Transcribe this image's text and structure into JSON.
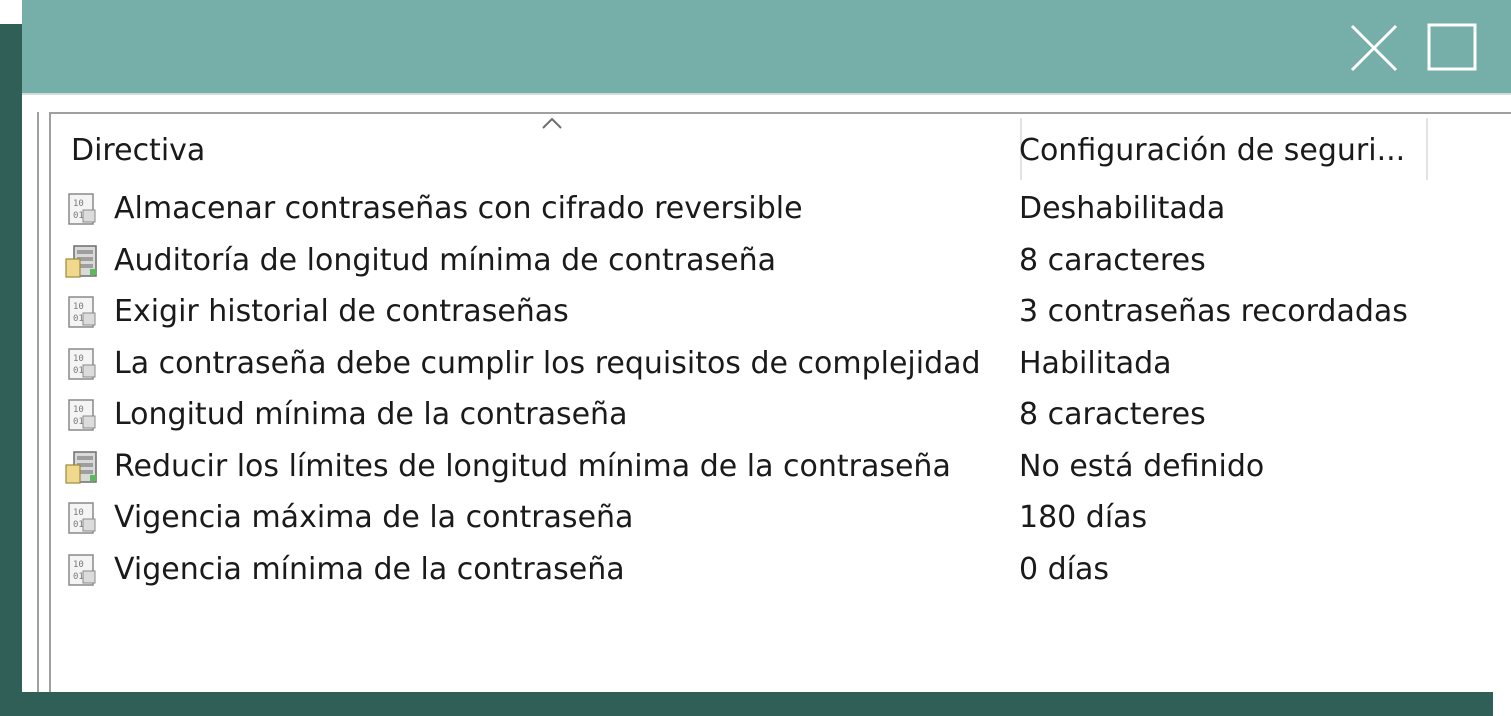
{
  "colors": {
    "titlebar": "#76aea9",
    "shadow": "#2f5f56",
    "text": "#1a1a1a"
  },
  "titlebar": {
    "close_icon": "close-icon",
    "maximize_icon": "maximize-icon"
  },
  "table": {
    "columns": [
      "Directiva",
      "Configuración de seguri..."
    ],
    "sort_indicator": "sort-ascending-icon",
    "rows": [
      {
        "name": "Almacenar contraseñas con cifrado reversible",
        "value": "Deshabilitada",
        "icon": "policy-doc-icon"
      },
      {
        "name": "Auditoría de longitud mínima de contraseña",
        "value": "8 caracteres",
        "icon": "policy-server-icon"
      },
      {
        "name": "Exigir historial de contraseñas",
        "value": "3 contraseñas recordadas",
        "icon": "policy-doc-icon"
      },
      {
        "name": "La contraseña debe cumplir los requisitos de complejidad",
        "value": "Habilitada",
        "icon": "policy-doc-icon"
      },
      {
        "name": "Longitud mínima de la contraseña",
        "value": "8 caracteres",
        "icon": "policy-doc-icon"
      },
      {
        "name": "Reducir los límites de longitud mínima de la contraseña",
        "value": "No está definido",
        "icon": "policy-server-icon"
      },
      {
        "name": "Vigencia máxima de la contraseña",
        "value": "180 días",
        "icon": "policy-doc-icon"
      },
      {
        "name": "Vigencia mínima de la contraseña",
        "value": "0 días",
        "icon": "policy-doc-icon"
      }
    ]
  }
}
